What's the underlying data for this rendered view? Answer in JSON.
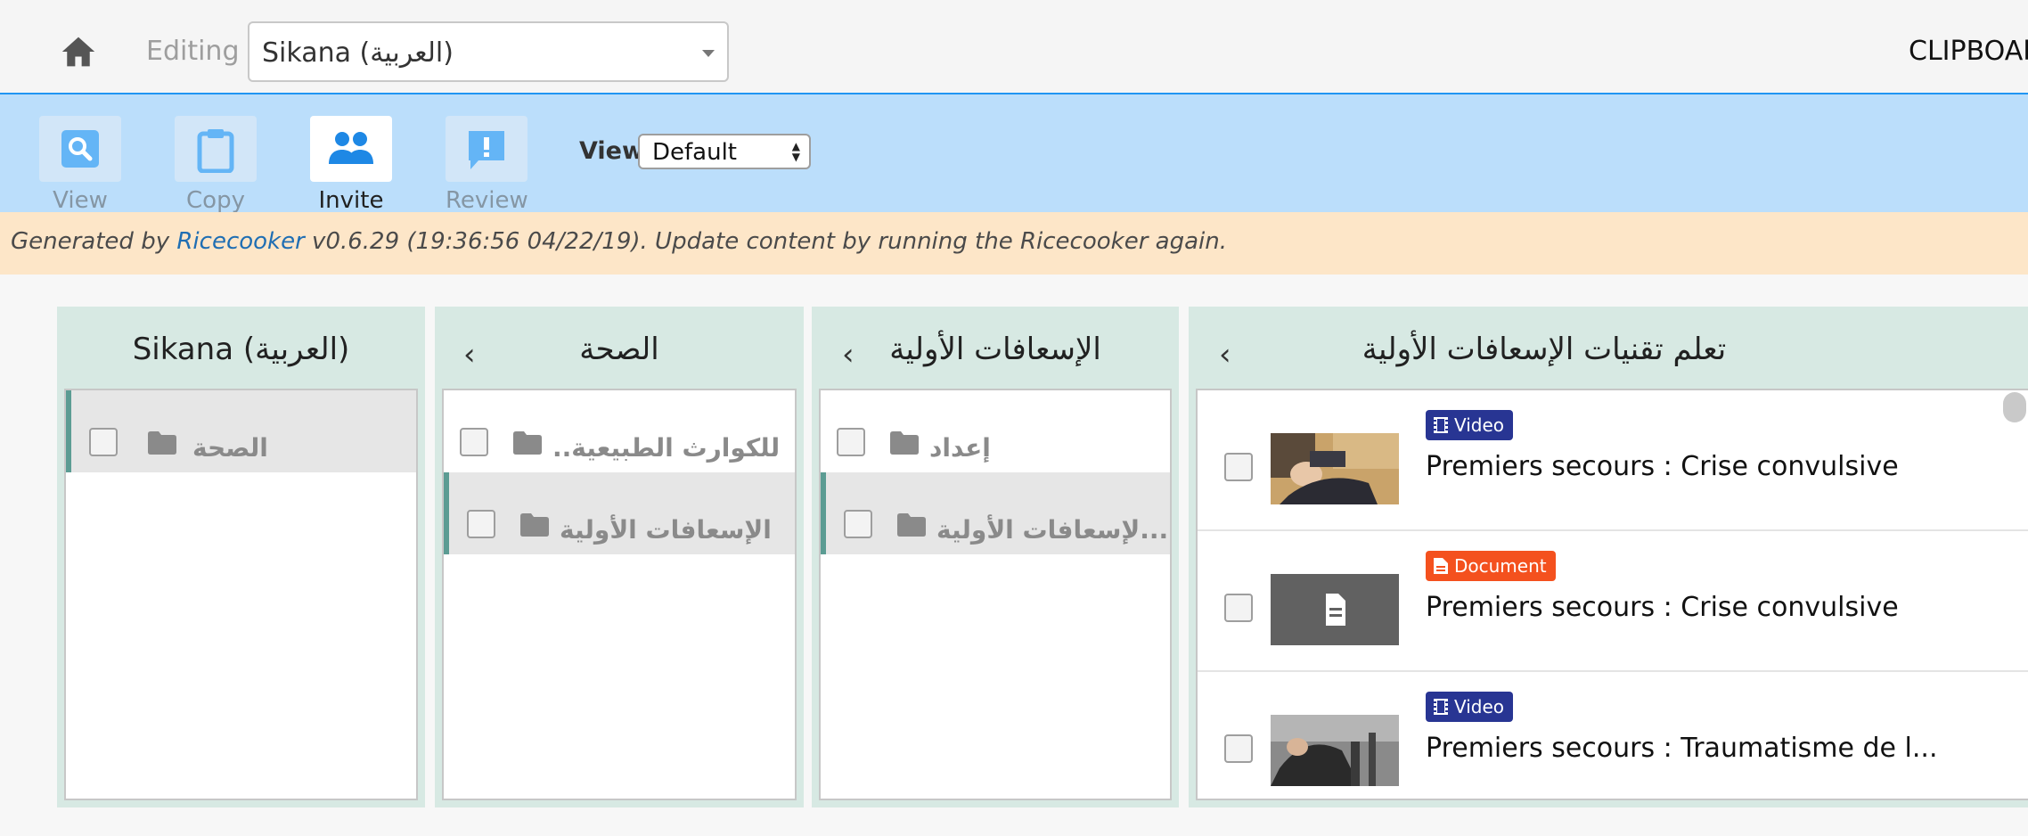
{
  "header": {
    "editing_label": "Editing",
    "channel_name": "Sikana (العربية)",
    "clipboard_label": "CLIPBOARD"
  },
  "toolbar": {
    "tools": [
      {
        "label": "View",
        "icon": "search-icon",
        "active": false
      },
      {
        "label": "Copy",
        "icon": "clipboard-icon",
        "active": false
      },
      {
        "label": "Invite",
        "icon": "people-icon",
        "active": true
      },
      {
        "label": "Review",
        "icon": "review-icon",
        "active": false
      }
    ],
    "view_label": "View",
    "view_value": "Default"
  },
  "banner": {
    "prefix": "Generated by ",
    "link": "Ricecooker",
    "suffix": " v0.6.29 (19:36:56 04/22/19). Update content by running the Ricecooker again."
  },
  "columns": [
    {
      "title": "Sikana (العربية)",
      "items": [
        {
          "name": "الصحة",
          "selected": true
        }
      ]
    },
    {
      "title": "الصحة",
      "items": [
        {
          "name": "للكوارث الطبيعية..",
          "selected": false
        },
        {
          "name": "الإسعافات الأولية",
          "selected": true
        }
      ]
    },
    {
      "title": "الإسعافات الأولية",
      "items": [
        {
          "name": "إعداد",
          "selected": false
        },
        {
          "name": "...لإسعافات الأولية",
          "selected": true
        }
      ]
    },
    {
      "title": "تعلم تقنيات الإسعافات الأولية",
      "items": [
        {
          "kind": "Video",
          "title": "Premiers secours : Crise convulsive"
        },
        {
          "kind": "Document",
          "title": "Premiers secours : Crise convulsive"
        },
        {
          "kind": "Video",
          "title": "Premiers secours : Traumatisme de l..."
        }
      ]
    }
  ],
  "colors": {
    "accent": "#2196f3",
    "toolbar_bg": "#bbdefb",
    "banner_bg": "#fde6c8",
    "column_bg": "#d7e9e3",
    "video_badge": "#283593",
    "document_badge": "#f4511e"
  }
}
